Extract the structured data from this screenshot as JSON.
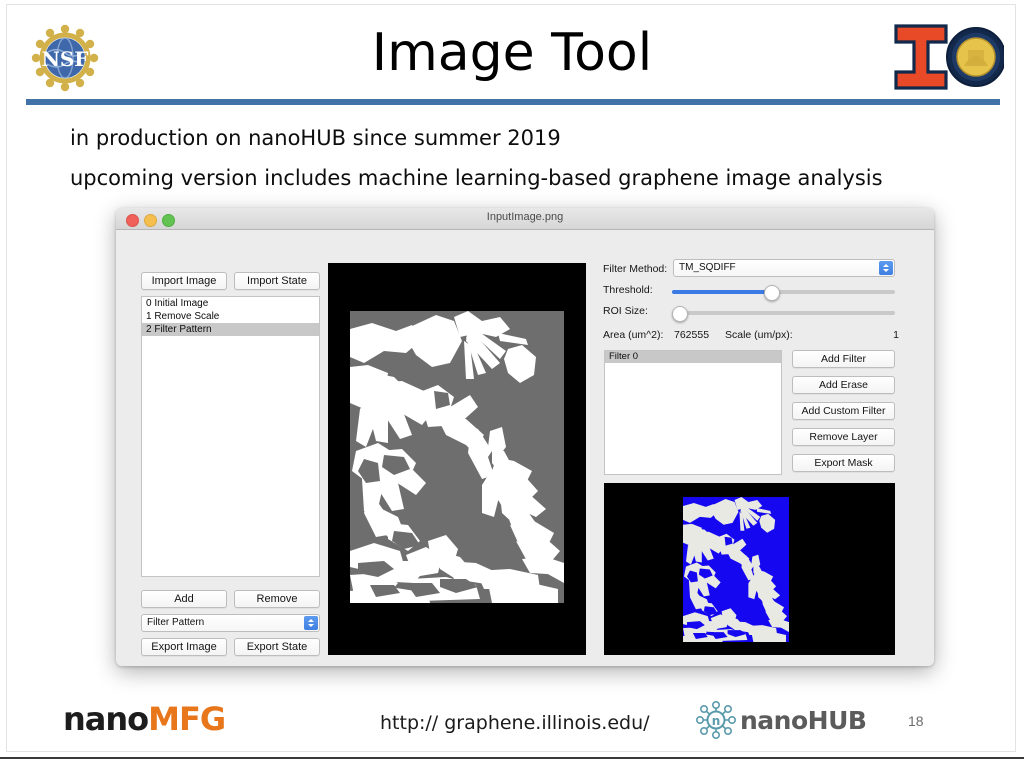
{
  "slide": {
    "title": "Image Tool",
    "page_number": "18",
    "divider_color": "#4172a8",
    "bullets": [
      "in production on nanoHUB since summer 2019",
      "upcoming version includes machine learning-based graphene image analysis"
    ]
  },
  "logos": {
    "nsf": {
      "text": "NSF",
      "globe_color": "#3f68aa",
      "ring_color": "#d3b14a"
    },
    "illinois": {
      "letter_i": "I",
      "i_color": "#e84a27",
      "outline_color": "#13294b",
      "seal_color": "#e6c34a"
    },
    "nanomfg": {
      "part1": "nano",
      "part2": "MFG",
      "part1_color": "#1d1d1d",
      "part2_color": "#e8761b"
    },
    "nanohub": {
      "text": "nanoHUB",
      "center_letter": "n",
      "icon_color": "#5a9aad",
      "text_color": "#5b5b5b"
    }
  },
  "footer": {
    "url": "http:// graphene.illinois.edu/"
  },
  "app": {
    "window_title": "InputImage.png",
    "traffic_lights": [
      "close-red",
      "minimize-yellow",
      "zoom-green"
    ],
    "left_panel": {
      "import_image": "Import Image",
      "import_state": "Import State",
      "layers": [
        {
          "label": "0 Initial Image",
          "selected": false
        },
        {
          "label": "1 Remove Scale",
          "selected": false
        },
        {
          "label": "2 Filter Pattern",
          "selected": true
        }
      ],
      "add": "Add",
      "remove": "Remove",
      "operation_select": "Filter Pattern",
      "export_image": "Export Image",
      "export_state": "Export State"
    },
    "right_panel": {
      "filter_method_label": "Filter Method:",
      "filter_method_value": "TM_SQDIFF",
      "threshold_label": "Threshold:",
      "threshold_percent": 44,
      "roi_label": "ROI Size:",
      "roi_percent": 0,
      "area_label": "Area (um^2):",
      "area_value": "762555",
      "scale_label": "Scale (um/px):",
      "scale_value": "1",
      "filter_list": [
        {
          "label": "Filter 0",
          "selected": true
        }
      ],
      "buttons": [
        "Add Filter",
        "Add Erase",
        "Add Custom Filter",
        "Remove Layer",
        "Export Mask"
      ]
    },
    "canvas": {
      "main_background": "#000000",
      "main_image_background": "#6e6e6e",
      "main_image_foreground": "#ffffff",
      "preview_background": "#000000",
      "preview_mask_color": "#1508f0",
      "preview_foreground": "#e9e9e4"
    }
  }
}
